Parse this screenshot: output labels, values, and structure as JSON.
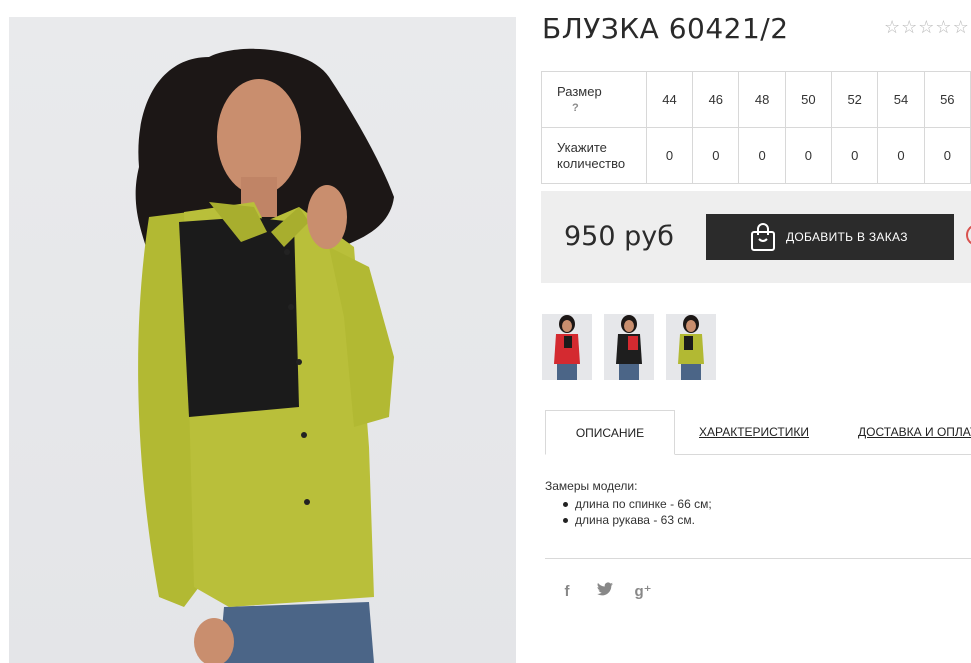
{
  "product": {
    "title": "БЛУЗКА 60421/2",
    "rating_stars": [
      "☆",
      "☆",
      "☆",
      "☆",
      "☆"
    ]
  },
  "size_table": {
    "header_label": "Размер",
    "help_mark": "?",
    "sizes": [
      "44",
      "46",
      "48",
      "50",
      "52",
      "54",
      "56"
    ],
    "qty_label_line1": "Укажите",
    "qty_label_line2": "количество",
    "quantities": [
      "0",
      "0",
      "0",
      "0",
      "0",
      "0",
      "0"
    ]
  },
  "buy": {
    "price": "950 руб",
    "add_button_label": "ДОБАВИТЬ В ЗАКАЗ"
  },
  "thumbnails": [
    {
      "name": "thumb-red",
      "shirt_color": "#d42a30"
    },
    {
      "name": "thumb-black-red",
      "shirt_color": "#1e1e1e"
    },
    {
      "name": "thumb-olive",
      "shirt_color": "#b2b933"
    }
  ],
  "tabs": [
    {
      "label": "ОПИСАНИЕ",
      "active": true
    },
    {
      "label": "ХАРАКТЕРИСТИКИ",
      "active": false
    },
    {
      "label": "ДОСТАВКА И ОПЛАТА",
      "active": false
    }
  ],
  "description": {
    "heading": "Замеры модели:",
    "items": [
      "длина по спинке - 66 см;",
      "длина рукава - 63 см."
    ]
  },
  "social": {
    "facebook": "f",
    "twitter": "🐦",
    "googleplus": "g⁺"
  },
  "colors": {
    "button_dark": "#2b2b2b",
    "blouse_olive": "#b2b933",
    "accent_heart": "#d9534f"
  }
}
